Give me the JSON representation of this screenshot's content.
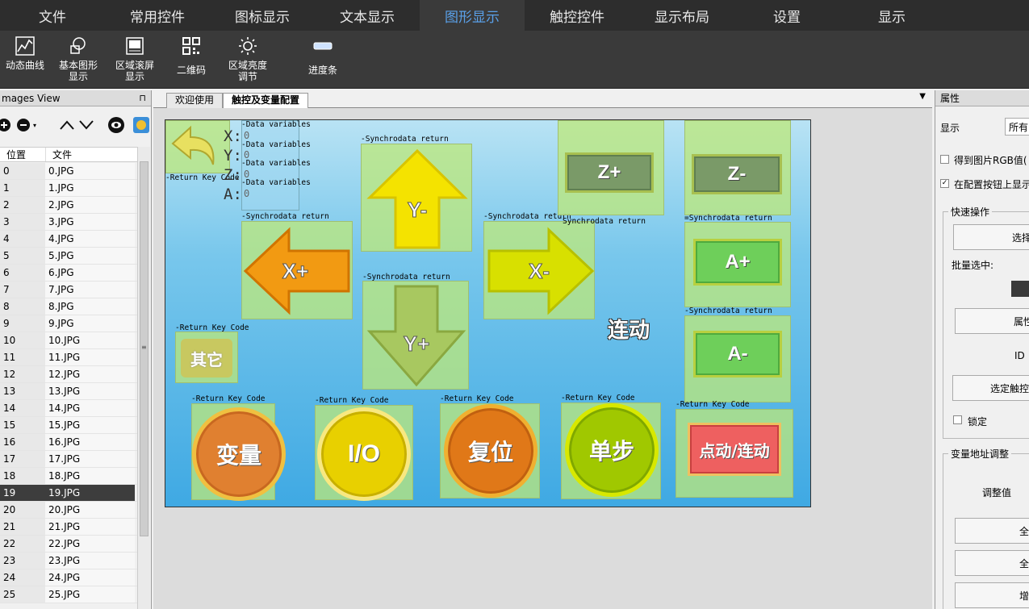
{
  "menu": {
    "items": [
      "文件",
      "常用控件",
      "图标显示",
      "文本显示",
      "图形显示",
      "触控控件",
      "显示布局",
      "设置",
      "显示"
    ],
    "active_index": 4
  },
  "ribbon": {
    "tools": [
      {
        "label": "动态曲线",
        "icon": "dynamic-curve-icon"
      },
      {
        "label": "基本图形\n显示",
        "icon": "basic-shapes-icon"
      },
      {
        "label": "区域滚屏\n显示",
        "icon": "scroll-region-icon"
      },
      {
        "label": "二维码",
        "icon": "qrcode-icon"
      },
      {
        "label": "区域亮度\n调节",
        "icon": "brightness-icon"
      },
      {
        "label": "进度条",
        "icon": "progress-bar-icon"
      }
    ]
  },
  "images_view": {
    "title": "mages View",
    "columns": [
      "位置",
      "文件"
    ],
    "rows": [
      [
        "0",
        "0.JPG"
      ],
      [
        "1",
        "1.JPG"
      ],
      [
        "2",
        "2.JPG"
      ],
      [
        "3",
        "3.JPG"
      ],
      [
        "4",
        "4.JPG"
      ],
      [
        "5",
        "5.JPG"
      ],
      [
        "6",
        "6.JPG"
      ],
      [
        "7",
        "7.JPG"
      ],
      [
        "8",
        "8.JPG"
      ],
      [
        "9",
        "9.JPG"
      ],
      [
        "10",
        "10.JPG"
      ],
      [
        "11",
        "11.JPG"
      ],
      [
        "12",
        "12.JPG"
      ],
      [
        "13",
        "13.JPG"
      ],
      [
        "14",
        "14.JPG"
      ],
      [
        "15",
        "15.JPG"
      ],
      [
        "16",
        "16.JPG"
      ],
      [
        "17",
        "17.JPG"
      ],
      [
        "18",
        "18.JPG"
      ],
      [
        "19",
        "19.JPG"
      ],
      [
        "20",
        "20.JPG"
      ],
      [
        "21",
        "21.JPG"
      ],
      [
        "22",
        "22.JPG"
      ],
      [
        "23",
        "23.JPG"
      ],
      [
        "24",
        "24.JPG"
      ],
      [
        "25",
        "25.JPG"
      ]
    ],
    "selected_index": 19
  },
  "tabs": {
    "items": [
      "欢迎使用",
      "触控及变量配置"
    ],
    "active_index": 1
  },
  "screen": {
    "axes": [
      "X:",
      "Y:",
      "Z:",
      "A:"
    ],
    "data_value": "0",
    "labels": {
      "data_var": "Data variables",
      "sync": "Synchrodata return",
      "key": "Return Key Code"
    },
    "arrows": {
      "y_minus": "Y-",
      "y_plus": "Y+",
      "x_plus": "X+",
      "x_minus": "X-"
    },
    "square_buttons": {
      "z_plus": "Z+",
      "z_minus": "Z-",
      "a_plus": "A+",
      "a_minus": "A-"
    },
    "other_button": "其它",
    "linkage_text": "连动",
    "round_buttons": [
      "变量",
      "I/O",
      "复位",
      "单步"
    ],
    "toggle_button": "点动/连动"
  },
  "properties": {
    "title": "属性",
    "display_label": "显示",
    "display_value": "所有",
    "checkbox_rgb": "得到图片RGB值(",
    "checkbox_show": "在配置按钮上显示",
    "quick_ops": "快速操作",
    "select_btn": "选择",
    "batch_select": "批量选中:",
    "prop_btn": "属性",
    "id_label": "ID",
    "select_touch_btn": "选定触控",
    "lock": "锁定",
    "var_addr": "变量地址调整",
    "adjust_value": "调整值",
    "btn_all_1": "全部",
    "btn_all_2": "全部",
    "btn_add": "增加"
  }
}
